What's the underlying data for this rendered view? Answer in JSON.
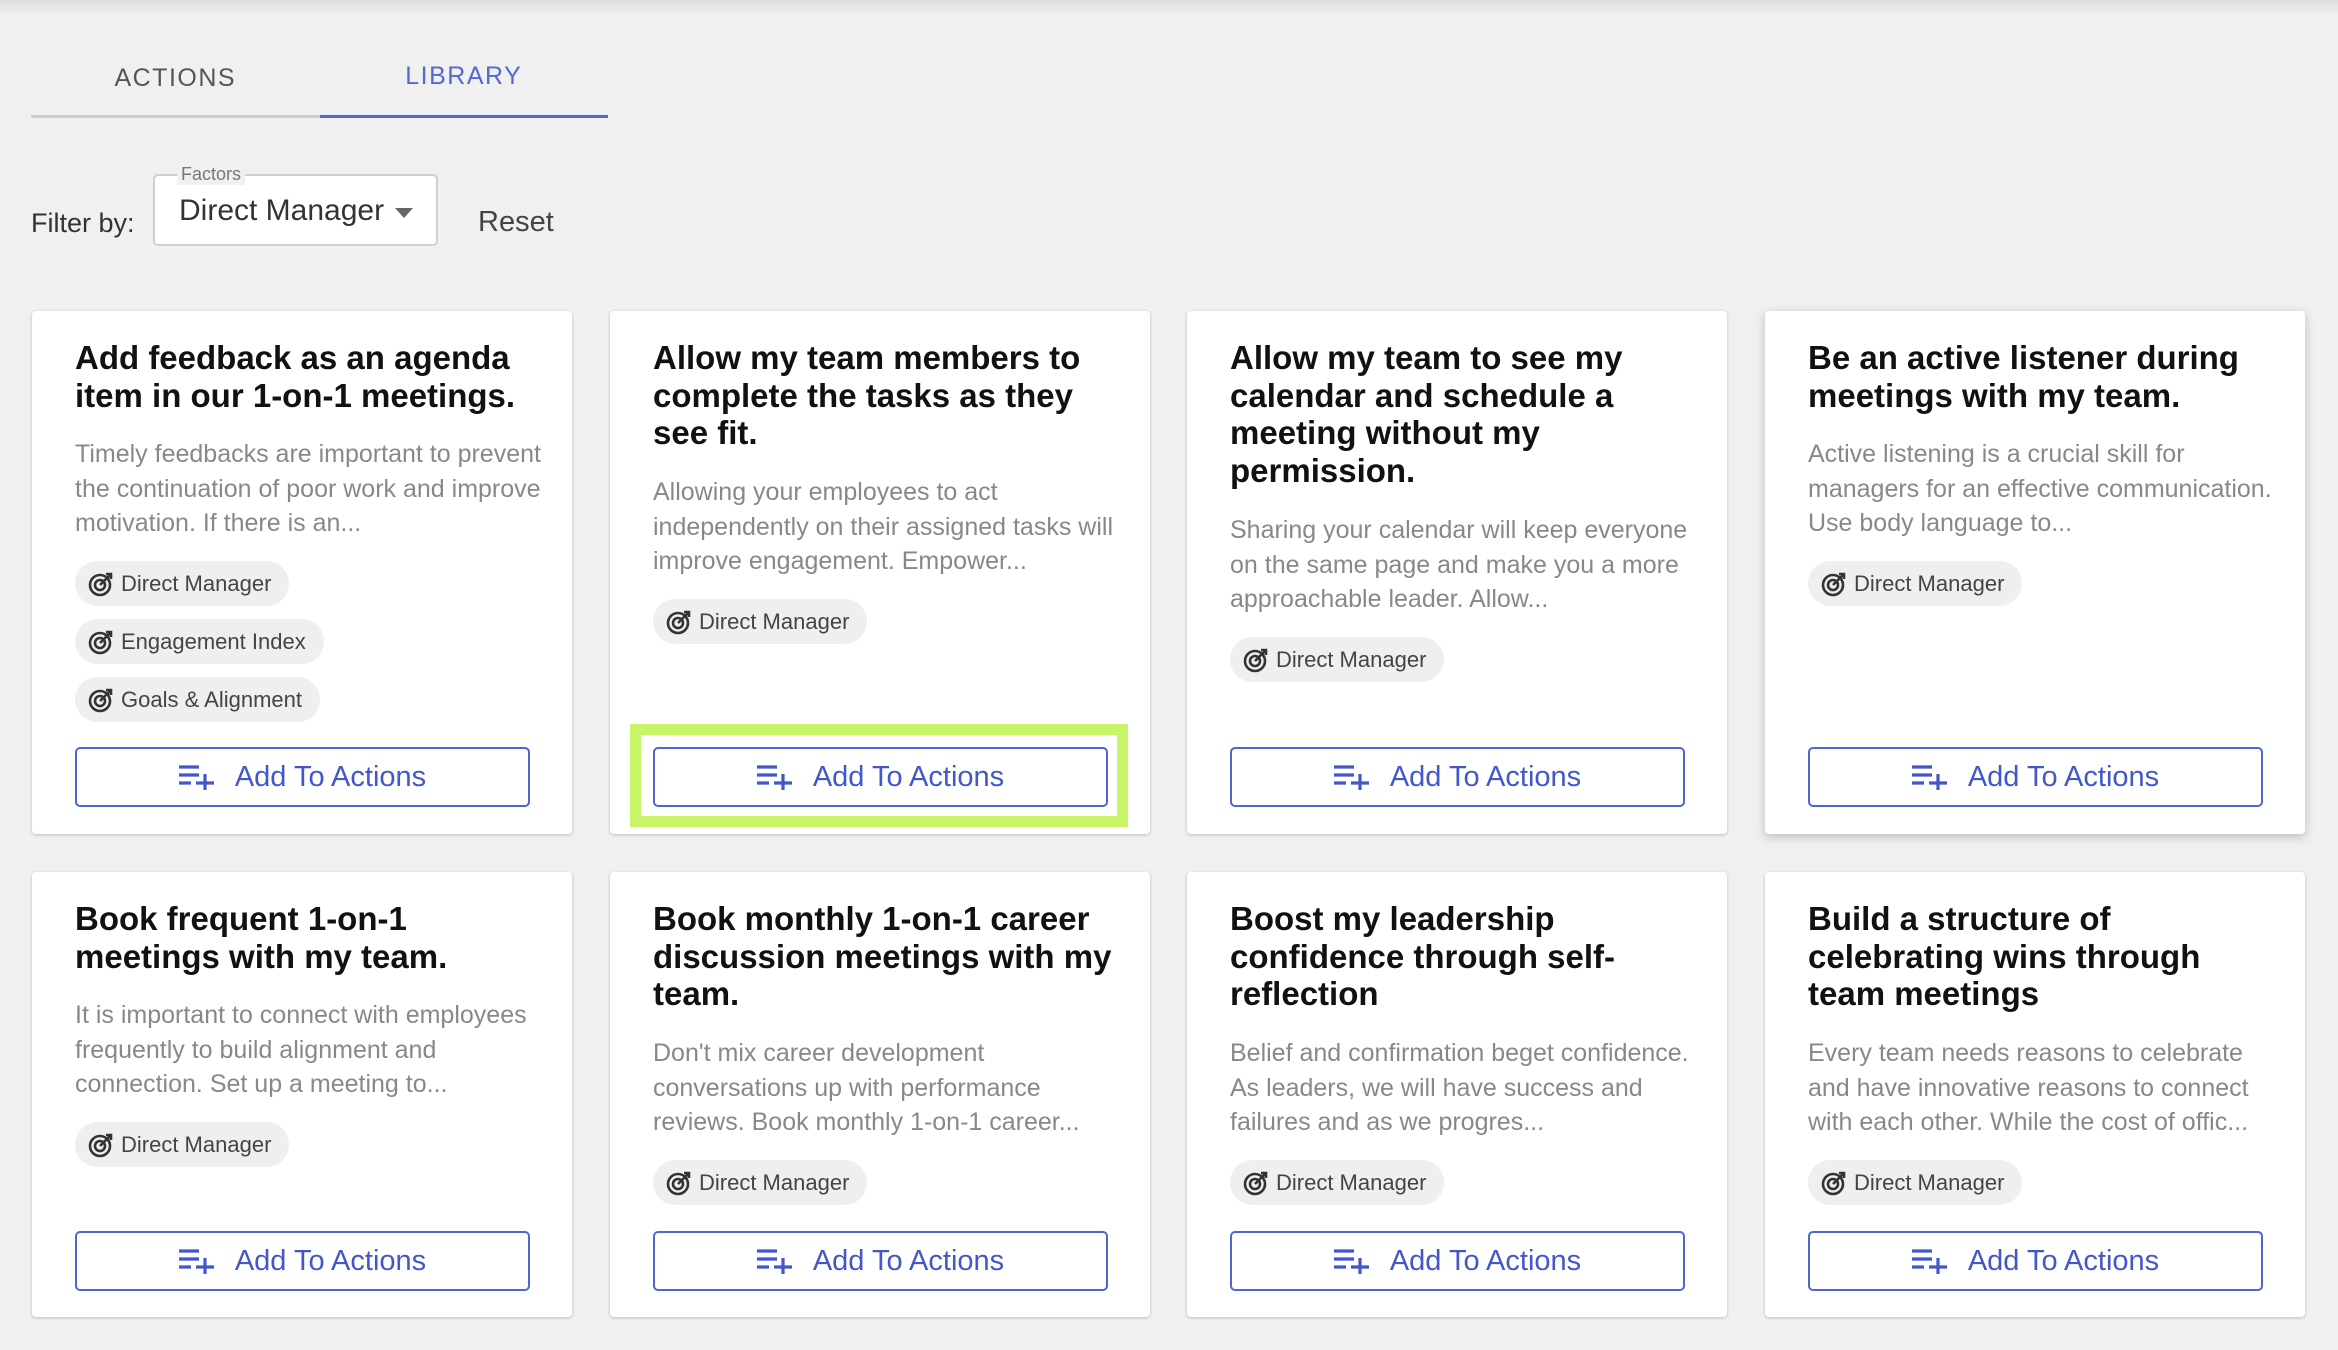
{
  "tabs": [
    {
      "label": "ACTIONS",
      "active": false
    },
    {
      "label": "LIBRARY",
      "active": true
    }
  ],
  "filter": {
    "label": "Filter by:",
    "select_legend": "Factors",
    "select_value": "Direct Manager",
    "reset_label": "Reset"
  },
  "colors": {
    "accent": "#4f65d0",
    "highlight": "#c8f568"
  },
  "icons": {
    "chip": "target-icon",
    "button": "playlist-add-icon",
    "select": "caret-down-icon"
  },
  "cards": [
    {
      "title": "Add feedback as an agenda item in our 1-on-1 meetings.",
      "description": "Timely feedbacks are important to prevent the continuation of poor work and improve motivation. If there is an...",
      "tags": [
        "Direct Manager",
        "Engagement Index",
        "Goals & Alignment"
      ],
      "button": "Add To Actions"
    },
    {
      "title": "Allow my team members to complete the tasks as they see fit.",
      "description": "Allowing your employees to act independently on their assigned tasks will improve engagement. Empower...",
      "tags": [
        "Direct Manager"
      ],
      "button": "Add To Actions",
      "highlighted": true
    },
    {
      "title": "Allow my team to see my calendar and schedule a meeting without my permission.",
      "description": "Sharing your calendar will keep everyone on the same page and make you a more approachable leader. Allow...",
      "tags": [
        "Direct Manager"
      ],
      "button": "Add To Actions"
    },
    {
      "title": "Be an active listener during meetings with my team.",
      "description": "Active listening is a crucial skill for managers for an effective communication. Use body language to...",
      "tags": [
        "Direct Manager"
      ],
      "button": "Add To Actions"
    },
    {
      "title": "Book frequent 1-on-1 meetings with my team.",
      "description": "It is important to connect with employees frequently to build alignment and connection. Set up a meeting to...",
      "tags": [
        "Direct Manager"
      ],
      "button": "Add To Actions"
    },
    {
      "title": "Book monthly 1-on-1 career discussion meetings with my team.",
      "description": "Don't mix career development conversations up with performance reviews. Book monthly 1-on-1 career...",
      "tags": [
        "Direct Manager"
      ],
      "button": "Add To Actions"
    },
    {
      "title": "Boost my leadership confidence through self-reflection",
      "description": "Belief and confirmation beget confidence. As leaders, we will have success and failures and as we progres...",
      "tags": [
        "Direct Manager"
      ],
      "button": "Add To Actions"
    },
    {
      "title": "Build a structure of celebrating wins through team meetings",
      "description": "Every team needs reasons to celebrate and have innovative reasons to connect with each other. While the cost of offic...",
      "tags": [
        "Direct Manager"
      ],
      "button": "Add To Actions"
    }
  ]
}
